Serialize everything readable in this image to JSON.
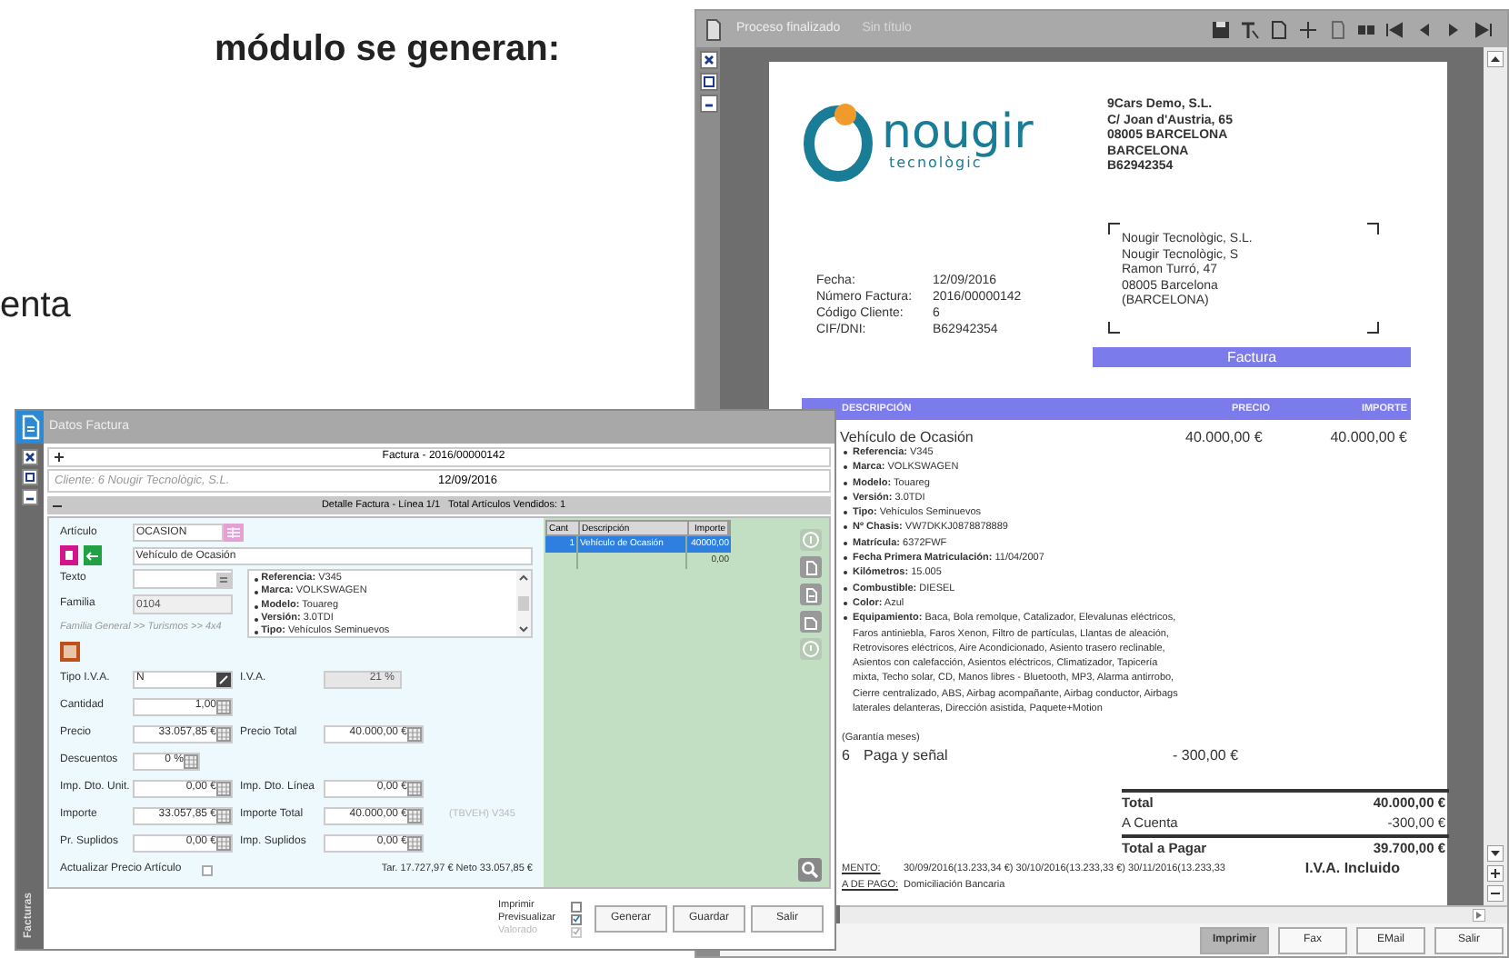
{
  "document_text": [
    {
      "text": "módulo se generan:"
    },
    {
      "text": "enta"
    }
  ],
  "report_window": {
    "title": "Proceso finalizado",
    "subtitle": "Sin título",
    "logo": {
      "name": "nougir",
      "tagline": "tecnològic"
    },
    "company": [
      "9Cars Demo, S.L.",
      "C/ Joan d'Austria, 65",
      "08005 BARCELONA",
      "BARCELONA",
      "B62942354"
    ],
    "recipient": [
      "Nougir Tecnològic, S.L.",
      "Nougir Tecnològic, S",
      "Ramon Turró, 47",
      "08005 Barcelona",
      "(BARCELONA)"
    ],
    "invoice_info": [
      {
        "label": "Fecha:",
        "value": "12/09/2016"
      },
      {
        "label": "Número Factura:",
        "value": "2016/00000142"
      },
      {
        "label": "Código Cliente:",
        "value": "6"
      },
      {
        "label": "CIF/DNI:",
        "value": "B62942354"
      }
    ],
    "invoice_heading": "Factura",
    "columns": [
      "DESCRIPCIÓN",
      "PRECIO",
      "IMPORTE"
    ],
    "item": {
      "description": "Vehículo de Ocasión",
      "price": "40.000,00 €",
      "amount": "40.000,00 €",
      "details": [
        {
          "label": "Referencia:",
          "value": "V345"
        },
        {
          "label": "Marca:",
          "value": "VOLKSWAGEN"
        },
        {
          "label": "Modelo:",
          "value": "Touareg"
        },
        {
          "label": "Versión:",
          "value": "3.0TDI"
        },
        {
          "label": "Tipo:",
          "value": "Vehículos Seminuevos"
        },
        {
          "label": "Nº Chasis:",
          "value": "VW7DKKJ0878878889"
        },
        {
          "label": "Matrícula:",
          "value": "6372FWF"
        },
        {
          "label": "Fecha Primera Matriculación:",
          "value": "11/04/2007"
        },
        {
          "label": "Kilómetros:",
          "value": "15.005"
        },
        {
          "label": "Combustible:",
          "value": "DIESEL"
        },
        {
          "label": "Color:",
          "value": "Azul"
        },
        {
          "label": "Equipamiento:",
          "value": "Baca, Bola remolque, Catalizador, Elevalunas eléctricos, Faros antiniebla, Faros Xenon, Filtro de partículas, Llantas de aleación, Retrovisores eléctricos, Aire Acondicionado, Asiento trasero reclinable, Asientos con calefacción, Asientos eléctricos, Climatizador, Tapicería mixta, Techo solar, CD, Manos libres - Bluetooth, MP3, Alarma antirrobo, Cierre centralizado, ABS, Airbag acompañante, Airbag conductor, Airbags laterales delanteras, Dirección asistida, Paquete+Motion"
        }
      ]
    },
    "warranty": "(Garantía  meses)",
    "payment": {
      "number": "6",
      "description": "Paga y señal",
      "price": "- 300,00 €"
    },
    "totals": [
      {
        "label": "Total",
        "value": "40.000,00 €",
        "kind": "bold"
      },
      {
        "label": "A Cuenta",
        "value": "-300,00 €",
        "kind": "plain"
      },
      {
        "label": "Total a Pagar",
        "value": "39.700,00 €",
        "kind": "grand"
      }
    ],
    "vat_note": "I.V.A. Incluido",
    "footer": [
      {
        "label": "MENTO:",
        "value": "30/09/2016(13.233,34 €) 30/10/2016(13.233,33 €) 30/11/2016(13.233,33"
      },
      {
        "label": "A DE PAGO:",
        "value": "Domiciliación Bancaria"
      }
    ],
    "buttons": [
      {
        "label": "Imprimir",
        "selected": true
      },
      {
        "label": "Fax",
        "selected": false
      },
      {
        "label": "EMail",
        "selected": false
      },
      {
        "label": "Salir",
        "selected": false
      }
    ]
  },
  "invoice_window": {
    "title": "Datos Factura",
    "sidebar_label": "Facturas",
    "header": "Factura - 2016/00000142",
    "client": "Cliente: 6 Nougir Tecnològic, S.L.",
    "date": "12/09/2016",
    "detail_header": "Detalle Factura - Línea 1/1   Total Artículos Vendidos: 1",
    "article": {
      "label": "Artículo",
      "code": "OCASION",
      "description": "Vehículo de Ocasión"
    },
    "text_field": {
      "label": "Texto"
    },
    "family": {
      "label": "Familia",
      "value": "0104"
    },
    "family_path": "Familia General >> Turismos >> 4x4",
    "details": [
      {
        "label": "Referencia:",
        "value": "V345"
      },
      {
        "label": "Marca:",
        "value": "VOLKSWAGEN"
      },
      {
        "label": "Modelo:",
        "value": "Touareg"
      },
      {
        "label": "Versión:",
        "value": "3.0TDI"
      },
      {
        "label": "Tipo:",
        "value": "Vehículos Seminuevos"
      }
    ],
    "rows": [
      [
        {
          "label": "Tipo I.V.A.",
          "value": "N",
          "kind": "select"
        },
        {
          "label": "I.V.A.",
          "value": "21 %",
          "kind": "disabled"
        }
      ],
      [
        {
          "label": "Cantidad",
          "value": "1,00",
          "kind": "number"
        }
      ],
      [
        {
          "label": "Precio",
          "value": "33.057,85 €",
          "kind": "number"
        },
        {
          "label": "Precio Total",
          "value": "40.000,00 €",
          "kind": "number"
        }
      ],
      [
        {
          "label": "Descuentos",
          "value": "0 %",
          "kind": "short"
        }
      ],
      [
        {
          "label": "Imp. Dto. Unit.",
          "value": "0,00 €",
          "kind": "number"
        },
        {
          "label": "Imp. Dto. Línea",
          "value": "0,00 €",
          "kind": "number"
        }
      ],
      [
        {
          "label": "Importe",
          "value": "33.057,85 €",
          "kind": "number"
        },
        {
          "label": "Importe Total",
          "value": "40.000,00 €",
          "kind": "number"
        },
        {
          "text": "(TBVEH) V345",
          "kind": "note"
        }
      ],
      [
        {
          "label": "Pr. Suplidos",
          "value": "0,00 €",
          "kind": "number"
        },
        {
          "label": "Imp. Suplidos",
          "value": "0,00 €",
          "kind": "number"
        }
      ]
    ],
    "update_price": {
      "label": "Actualizar Precio Artículo",
      "checked": false
    },
    "summary": "Tar. 17.727,97 € Neto 33.057,85 €",
    "grid": {
      "columns": [
        "Cant",
        "Descripción",
        "Importe"
      ],
      "rows": [
        {
          "quantity": "1",
          "description": "Vehículo de Ocasión",
          "amount": "40000,00",
          "selected": true
        },
        {
          "amount": "0,00",
          "selected": false
        }
      ]
    },
    "options": [
      {
        "label": "Imprimir",
        "checked": false,
        "disabled": false
      },
      {
        "label": "Previsualizar",
        "checked": true,
        "disabled": false
      },
      {
        "label": "Valorado",
        "checked": true,
        "disabled": true
      }
    ],
    "buttons": [
      "Generar",
      "Guardar",
      "Salir"
    ]
  }
}
